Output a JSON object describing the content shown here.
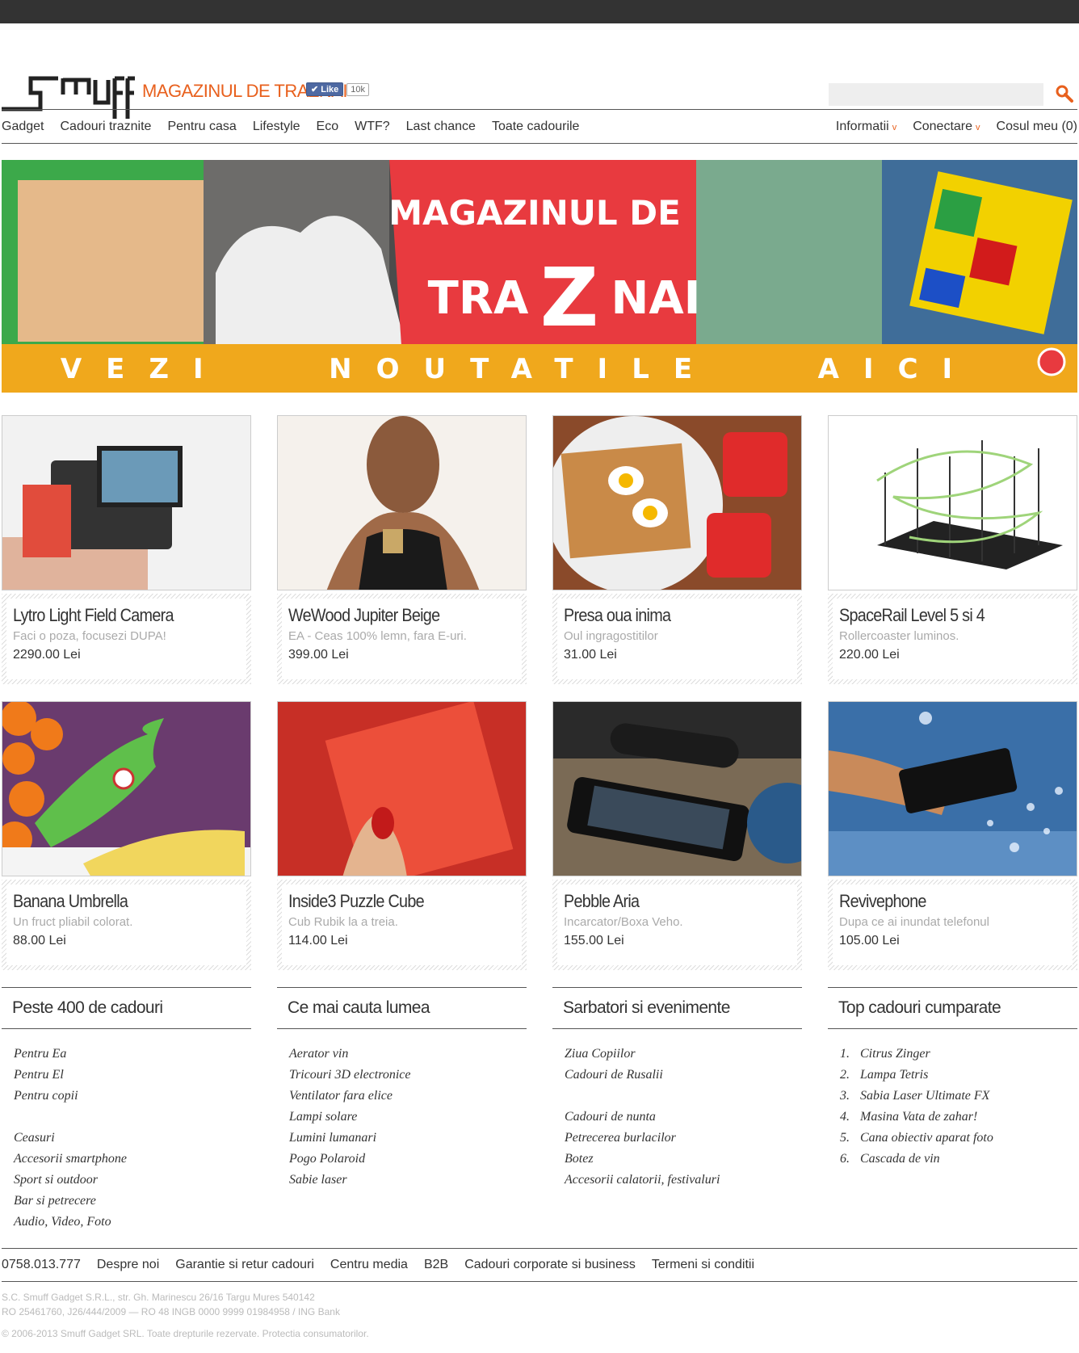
{
  "header": {
    "tagline": "MAGAZINUL DE TRAZNAI",
    "like_label": "Like",
    "like_count": "10k",
    "search_placeholder": ""
  },
  "nav": {
    "left": [
      "Gadget",
      "Cadouri traznite",
      "Pentru casa",
      "Lifestyle",
      "Eco",
      "WTF?",
      "Last chance",
      "Toate cadourile"
    ],
    "info": "Informatii",
    "login": "Conectare",
    "cart": "Cosul meu (0)"
  },
  "banner": {
    "line1": "MAGAZINUL DE",
    "line2a": "TRA",
    "line2z": "Z",
    "line2b": "NAI",
    "strip": "VEZI   NOUTATILE   AICI"
  },
  "products": [
    {
      "title": "Lytro Light Field Camera",
      "sub": "Faci o poza, focusezi DUPA!",
      "price": "2290.00 Lei"
    },
    {
      "title": "WeWood Jupiter Beige",
      "sub": "EA - Ceas 100% lemn, fara E-uri.",
      "price": "399.00 Lei"
    },
    {
      "title": "Presa oua inima",
      "sub": "Oul ingragostitilor",
      "price": "31.00 Lei"
    },
    {
      "title": "SpaceRail Level 5 si 4",
      "sub": "Rollercoaster luminos.",
      "price": "220.00 Lei"
    },
    {
      "title": "Banana Umbrella",
      "sub": "Un fruct pliabil colorat.",
      "price": "88.00 Lei"
    },
    {
      "title": "Inside3 Puzzle Cube",
      "sub": "Cub Rubik la a treia.",
      "price": "114.00 Lei"
    },
    {
      "title": "Pebble Aria",
      "sub": "Incarcator/Boxa Veho.",
      "price": "155.00 Lei"
    },
    {
      "title": "Revivephone",
      "sub": "Dupa ce ai inundat telefonul",
      "price": "105.00 Lei"
    }
  ],
  "columns": [
    {
      "title": "Peste 400 de cadouri",
      "items": [
        "Pentru Ea",
        "Pentru El",
        "Pentru copii",
        "",
        "Ceasuri",
        "Accesorii smartphone",
        "Sport si outdoor",
        "Bar si petrecere",
        "Audio, Video, Foto"
      ]
    },
    {
      "title": "Ce mai cauta lumea",
      "items": [
        "Aerator vin",
        "Tricouri 3D electronice",
        "Ventilator fara elice",
        "Lampi solare",
        "Lumini lumanari",
        "Pogo Polaroid",
        "Sabie laser"
      ]
    },
    {
      "title": "Sarbatori si evenimente",
      "items": [
        "Ziua Copiilor",
        "Cadouri de Rusalii",
        "",
        "Cadouri de nunta",
        "Petrecerea burlacilor",
        "Botez",
        "Accesorii calatorii, festivaluri"
      ]
    },
    {
      "title": "Top cadouri cumparate",
      "items": [
        "Citrus Zinger",
        "Lampa Tetris",
        "Sabia Laser Ultimate FX",
        "Masina Vata de zahar!",
        "Cana obiectiv aparat foto",
        "Cascada de vin"
      ]
    }
  ],
  "footer": {
    "links": [
      "0758.013.777",
      "Despre noi",
      "Garantie si retur cadouri",
      "Centru media",
      "B2B",
      "Cadouri corporate si business",
      "Termeni si conditii"
    ],
    "legal1": "S.C. Smuff Gadget S.R.L., str. Gh. Marinescu 26/16 Targu Mures 540142",
    "legal2": "RO 25461760, J26/444/2009 — RO 48 INGB 0000 9999 01984958 / ING Bank",
    "copyright": "© 2006-2013 Smuff Gadget SRL. Toate drepturile rezervate. Protectia consumatorilor."
  },
  "colors": {
    "accent": "#e8601d",
    "banner_red": "#e83a3f",
    "banner_strip": "#f0a81c",
    "dark": "#333333"
  }
}
